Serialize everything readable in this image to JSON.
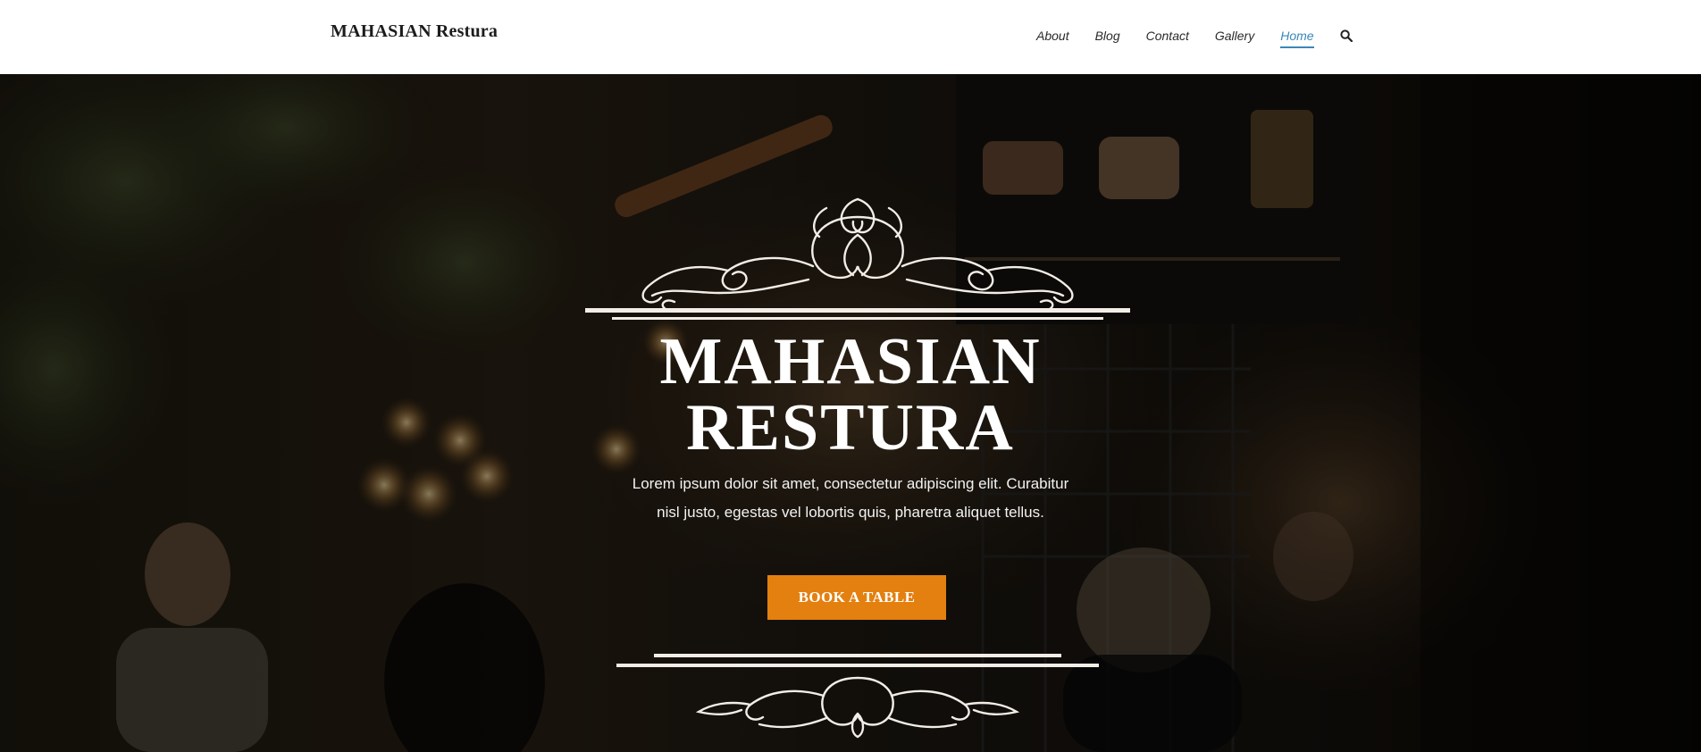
{
  "header": {
    "brand": "MAHASIAN Restura",
    "nav": [
      {
        "label": "About",
        "active": false
      },
      {
        "label": "Blog",
        "active": false
      },
      {
        "label": "Contact",
        "active": false
      },
      {
        "label": "Gallery",
        "active": false
      },
      {
        "label": "Home",
        "active": true
      }
    ],
    "search_icon": "search-icon",
    "active_color": "#3a87b8"
  },
  "hero": {
    "title_line1": "MAHASIAN",
    "title_line2": "RESTURA",
    "text": "Lorem ipsum dolor sit amet, consectetur adipiscing elit. Curabitur nisl justo, egestas vel lobortis quis, pharetra aliquet tellus.",
    "button_label": "BOOK A TABLE",
    "button_color": "#e4800f",
    "background": "restaurant-interior-photo",
    "ornament_icon": "flourish-ornament-icon"
  }
}
